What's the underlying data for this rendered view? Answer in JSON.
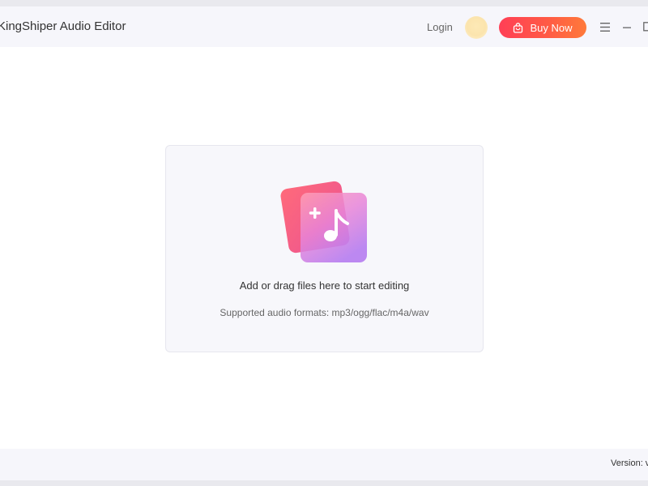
{
  "window": {
    "title": "KingShiper Audio Editor"
  },
  "header": {
    "login_label": "Login",
    "buy_label": "Buy Now",
    "buy_icon": "shopping-bag-icon",
    "menu_icon": "menu-icon",
    "minimize_icon": "minimize-icon",
    "maximize_icon": "maximize-icon"
  },
  "dropzone": {
    "title": "Add or drag files here to start editing",
    "subtitle": "Supported audio formats: mp3/ogg/flac/m4a/wav",
    "icon": "add-music-icon"
  },
  "status": {
    "version_label": "Version: v"
  },
  "colors": {
    "accent_start": "#ff3f56",
    "accent_end": "#ff7a3a",
    "titlebar_bg": "#f6f6fb",
    "dropzone_bg": "#f7f7fb"
  }
}
